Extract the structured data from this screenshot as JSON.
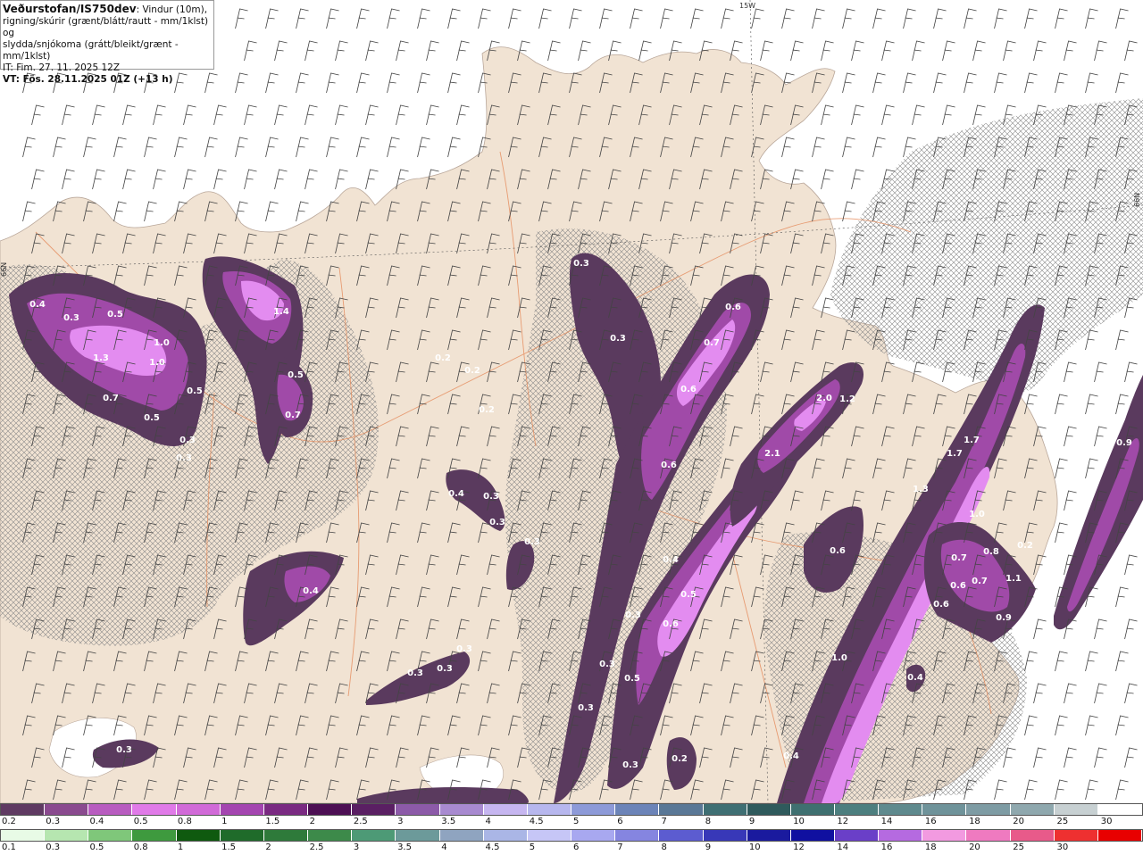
{
  "header": {
    "title": "Veðurstofan/IS750dev",
    "line1_rest": ": Vindur (10m),",
    "line2": "rigning/skúrir (grænt/blátt/rautt - mm/1klst) og",
    "line3": "slydda/snjókoma (grátt/bleikt/grænt - mm/1klst)",
    "issue": "IT: Fim. 27. 11. 2025 12Z",
    "valid": "VT: Fös. 28.11.2025 01Z (+13 h)"
  },
  "map_labels": {
    "lon_top": "15W",
    "lat_left": "66N",
    "lat_right": "66N"
  },
  "colors": {
    "land": "#f1e3d3",
    "sea": "#ffffff",
    "roads": "#e58a5a",
    "hatch": "#8a8a8a",
    "precip_low": "#5a3a5e",
    "precip_mid": "#a04aa8",
    "precip_high": "#e38cf0",
    "precip_peak": "#ff7dff"
  },
  "precip_values": [
    "0.4",
    "0.3",
    "0.5",
    "1.0",
    "1.3",
    "1.0",
    "0.7",
    "0.5",
    "0.5",
    "0.3",
    "0.3",
    "1.4",
    "0.5",
    "0.7",
    "0.3",
    "0.2",
    "0.2",
    "0.2",
    "0.4",
    "0.3",
    "0.3",
    "0.3",
    "0.4",
    "0.3",
    "0.3",
    "0.3",
    "0.3",
    "0.6",
    "0.7",
    "0.6",
    "0.6",
    "0.4",
    "0.5",
    "0.6",
    "0.3",
    "0.3",
    "0.5",
    "0.3",
    "0.3",
    "0.2",
    "2.0",
    "1.2",
    "2.1",
    "0.6",
    "1.7",
    "1.7",
    "1.3",
    "1.0",
    "0.7",
    "0.8",
    "0.2",
    "0.6",
    "0.7",
    "1.1",
    "0.6",
    "0.9",
    "1.0",
    "0.4",
    "0.4",
    "0.9",
    "0.3"
  ],
  "scale_snow": {
    "labels": [
      "0.2",
      "0.3",
      "0.4",
      "0.5",
      "0.8",
      "1",
      "1.5",
      "2",
      "2.5",
      "3",
      "3.5",
      "4",
      "4.5",
      "5",
      "6",
      "7",
      "8",
      "9",
      "10",
      "12",
      "14",
      "16",
      "18",
      "20",
      "25",
      "30"
    ],
    "colors": [
      "#5f3a62",
      "#8a4a8f",
      "#b85cc0",
      "#e07ae8",
      "#d16ad8",
      "#a445b0",
      "#7a2a82",
      "#4d0f54",
      "#5a1f63",
      "#8c5aa8",
      "#a88ad0",
      "#c6b6f0",
      "#b7b7ee",
      "#8d9ad8",
      "#6c84b8",
      "#5a7896",
      "#3f6f73",
      "#2f5a5c",
      "#3f7070",
      "#4d7f7f",
      "#5f8a8e",
      "#6f939a",
      "#7e9ca4",
      "#8fa8ae",
      "#c7d0d2",
      "#ffffff"
    ]
  },
  "scale_rain": {
    "labels": [
      "0.1",
      "0.3",
      "0.5",
      "0.8",
      "1",
      "1.5",
      "2",
      "2.5",
      "3",
      "3.5",
      "4",
      "4.5",
      "5",
      "6",
      "7",
      "8",
      "9",
      "10",
      "12",
      "14",
      "16",
      "18",
      "20",
      "25",
      "30"
    ],
    "colors": [
      "#e8fbe6",
      "#b6e6b0",
      "#7fc77a",
      "#3e9a3e",
      "#0f5a0f",
      "#1f6b2a",
      "#2e7a3a",
      "#3d8a4a",
      "#4d9a76",
      "#6c9a9a",
      "#8fa4c0",
      "#aab6e6",
      "#c6c6f6",
      "#a8a8f0",
      "#8585e0",
      "#5c5cd0",
      "#3838b8",
      "#1a1a9e",
      "#1010a0",
      "#6a3fc8",
      "#b56ae0",
      "#f29ae0",
      "#ef7ac0",
      "#e85a8a",
      "#ee3030",
      "#e80000"
    ]
  }
}
